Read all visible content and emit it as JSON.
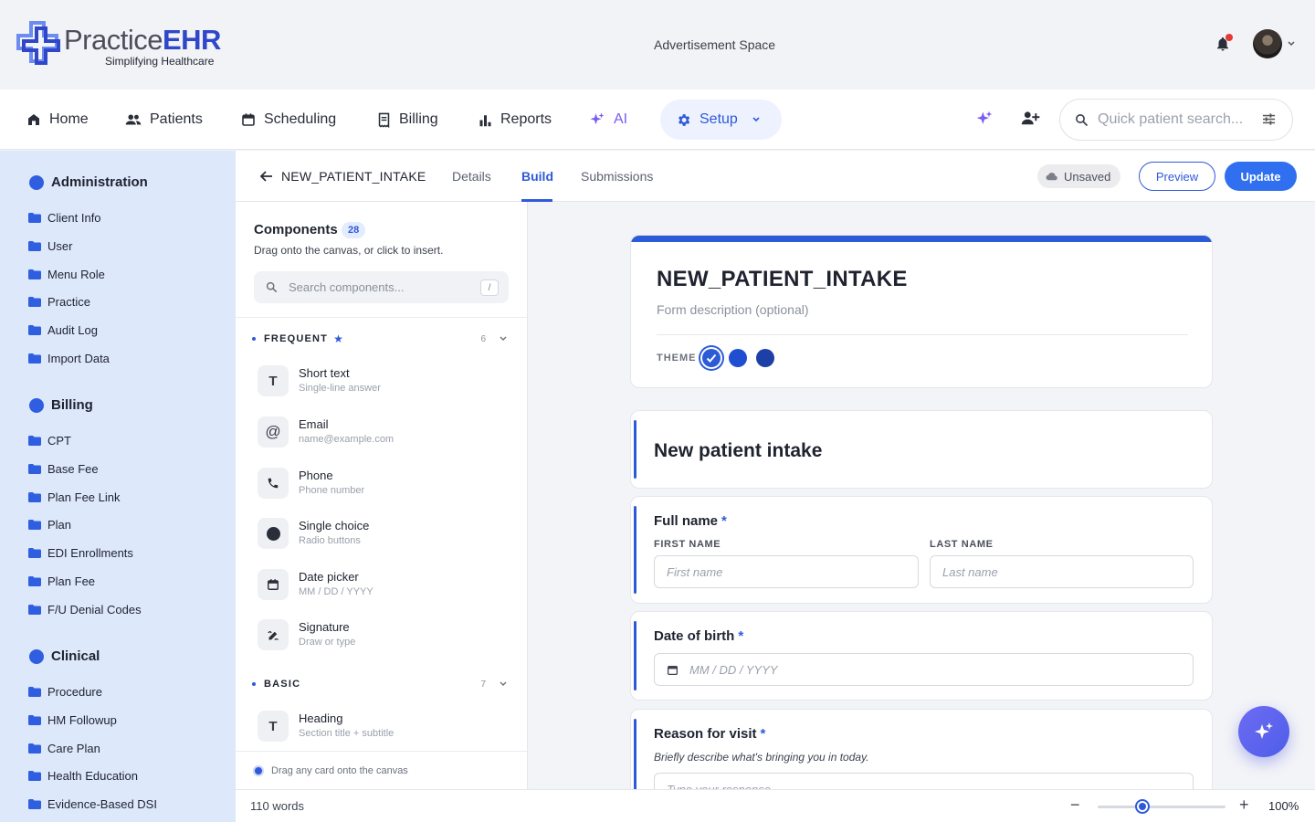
{
  "brand": {
    "name_part1": "Practice",
    "name_part2": "EHR",
    "tagline": "Simplifying Healthcare"
  },
  "header": {
    "ad_space": "Advertisement Space",
    "notifications_unread": true
  },
  "nav": {
    "items": [
      {
        "label": "Home",
        "icon": "home-icon"
      },
      {
        "label": "Patients",
        "icon": "people-icon"
      },
      {
        "label": "Scheduling",
        "icon": "calendar-icon"
      },
      {
        "label": "Billing",
        "icon": "receipt-icon"
      },
      {
        "label": "Reports",
        "icon": "bar-chart-icon"
      },
      {
        "label": "AI",
        "icon": "sparkle-icon"
      }
    ],
    "setup_label": "Setup",
    "quick_search_placeholder": "Quick patient search..."
  },
  "sidebar": {
    "sections": [
      {
        "title": "Administration",
        "items": [
          "Client Info",
          "User",
          "Menu Role",
          "Practice",
          "Audit Log",
          "Import Data"
        ]
      },
      {
        "title": "Billing",
        "items": [
          "CPT",
          "Base Fee",
          "Plan Fee Link",
          "Plan",
          "EDI Enrollments",
          "Plan Fee",
          "F/U Denial Codes"
        ]
      },
      {
        "title": "Clinical",
        "items": [
          "Procedure",
          "HM Followup",
          "Care Plan",
          "Health Education",
          "Evidence-Based DSI"
        ]
      }
    ]
  },
  "subheader": {
    "form_name": "NEW_PATIENT_INTAKE",
    "tabs": [
      "Details",
      "Build",
      "Submissions"
    ],
    "active_tab": "Build",
    "status": "Unsaved",
    "preview_label": "Preview",
    "update_label": "Update"
  },
  "components": {
    "title": "Components",
    "count": "28",
    "hint": "Drag onto the canvas, or click to insert.",
    "search_placeholder": "Search components...",
    "search_shortcut": "/",
    "groups": [
      {
        "name": "FREQUENT",
        "count": "6",
        "items": [
          {
            "name": "Short text",
            "sub": "Single-line answer",
            "icon": "text-icon"
          },
          {
            "name": "Email",
            "sub": "name@example.com",
            "icon": "at-icon"
          },
          {
            "name": "Phone",
            "sub": "Phone number",
            "icon": "phone-icon"
          },
          {
            "name": "Single choice",
            "sub": "Radio buttons",
            "icon": "radio-icon"
          },
          {
            "name": "Date picker",
            "sub": "MM / DD / YYYY",
            "icon": "calendar-icon"
          },
          {
            "name": "Signature",
            "sub": "Draw or type",
            "icon": "signature-icon"
          }
        ]
      },
      {
        "name": "BASIC",
        "count": "7",
        "items": [
          {
            "name": "Heading",
            "sub": "Section title + subtitle",
            "icon": "text-icon"
          }
        ]
      }
    ],
    "footer_hint": "Drag any card onto the canvas"
  },
  "form": {
    "title": "NEW_PATIENT_INTAKE",
    "description_placeholder": "Form description (optional)",
    "theme_label": "THEME",
    "theme_colors": [
      "#2b5bd7",
      "#1f4fd0",
      "#1d3fa6"
    ],
    "selected_theme": 0,
    "heading": "New patient intake",
    "fields": {
      "full_name": {
        "label": "Full name",
        "required": "*",
        "first_label": "FIRST NAME",
        "first_placeholder": "First name",
        "last_label": "LAST NAME",
        "last_placeholder": "Last name"
      },
      "dob": {
        "label": "Date of birth",
        "required": "*",
        "placeholder": "MM / DD / YYYY"
      },
      "reason": {
        "label": "Reason for visit",
        "required": "*",
        "help": "Briefly describe what's bringing you in today.",
        "placeholder": "Type your response..."
      }
    }
  },
  "status_bar": {
    "word_count": "110 words",
    "zoom": "100%",
    "zoom_level": 0.35
  },
  "colors": {
    "accent": "#2f59d9",
    "sidebar_bg": "#dde8fb",
    "ai": "#7b5cf0"
  }
}
